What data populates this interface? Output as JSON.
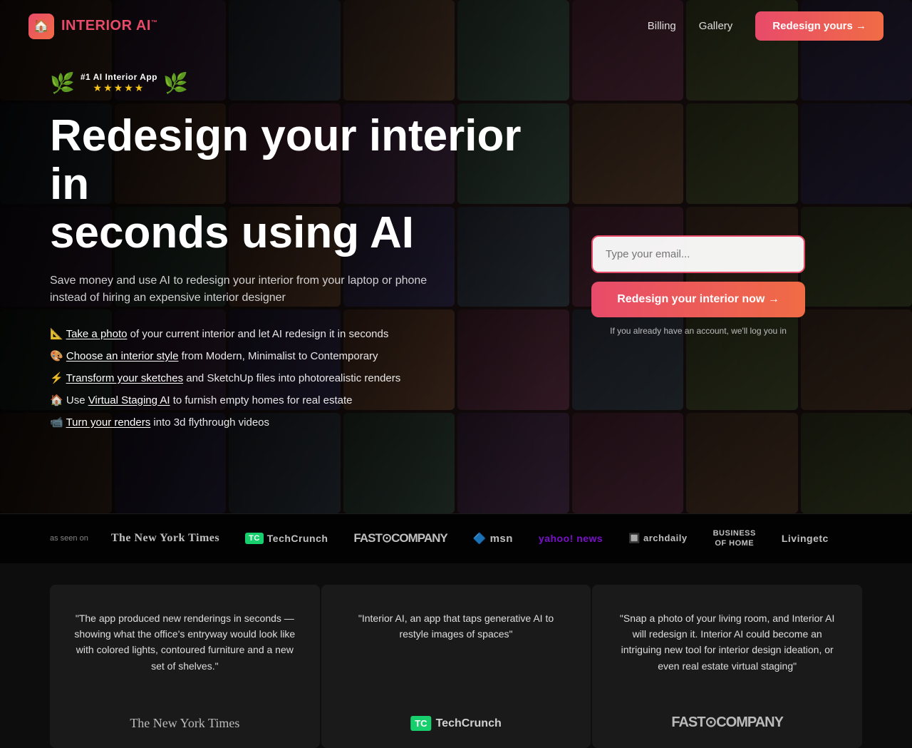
{
  "nav": {
    "logo_text": "INTERIOR AI",
    "logo_tm": "™",
    "billing_label": "Billing",
    "gallery_label": "Gallery",
    "cta_label": "Redesign yours →"
  },
  "hero": {
    "award_title": "#1 AI Interior App",
    "award_stars": "★★★★★",
    "heading_line1": "Redesign your interior in",
    "heading_line2": "seconds using AI",
    "subtext": "Save money and use AI to redesign your interior from your laptop or phone instead of hiring an expensive interior designer",
    "features": [
      {
        "emoji": "📐",
        "link_text": "Take a photo",
        "rest": " of your current interior and let AI redesign it in seconds"
      },
      {
        "emoji": "🎨",
        "link_text": "Choose an interior style",
        "rest": " from Modern, Minimalist to Contemporary"
      },
      {
        "emoji": "⚡",
        "link_text": "Transform your sketches",
        "rest": " and SketchUp files into photorealistic renders"
      },
      {
        "emoji": "🏠",
        "link_text": "Virtual Staging AI",
        "prefix": "Use ",
        "rest": " to furnish empty homes for real estate"
      },
      {
        "emoji": "📹",
        "link_text": "Turn your renders",
        "rest": " into 3d flythrough videos"
      }
    ],
    "email_placeholder": "Type your email...",
    "cta_button": "Redesign your interior now →",
    "cta_footnote": "If you already have an account, we'll log you in"
  },
  "press": {
    "as_seen_on": "as seen on",
    "logos": [
      {
        "name": "The New York Times",
        "style": "nyt"
      },
      {
        "name": "TechCrunch",
        "style": "tc"
      },
      {
        "name": "FAST⊙COMPANY",
        "style": "fc"
      },
      {
        "name": "msn",
        "style": "msn"
      },
      {
        "name": "yahoo! news",
        "style": "yahoo"
      },
      {
        "name": "archdaily",
        "style": "archdaily"
      },
      {
        "name": "BUSINESS OF HOME",
        "style": "boh"
      },
      {
        "name": "Livingetc",
        "style": "livingetc"
      }
    ]
  },
  "testimonials": [
    {
      "text": "\"The app produced new renderings in seconds — showing what the office's entryway would look like with colored lights, contoured furniture and a new set of shelves.\"",
      "logo_type": "nyt",
      "logo_text": "The New York Times"
    },
    {
      "text": "\"Interior AI, an app that taps generative AI to restyle images of spaces\"",
      "logo_type": "tc",
      "logo_text": "TechCrunch"
    },
    {
      "text": "\"Snap a photo of your living room, and Interior AI will redesign it. Interior AI could become an intriguing new tool for interior design ideation, or even real estate virtual staging\"",
      "logo_type": "fc",
      "logo_text": "FAST⊙COMPANY"
    }
  ],
  "colors": {
    "accent_gradient_start": "#e84b6a",
    "accent_gradient_end": "#f06c45",
    "background": "#111111"
  }
}
